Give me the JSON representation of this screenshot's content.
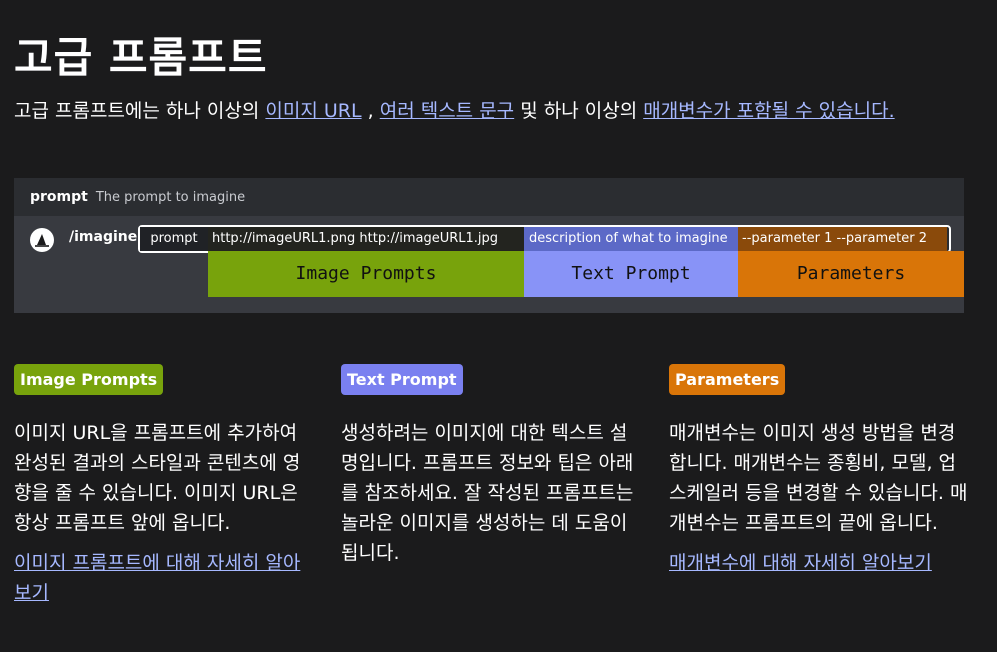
{
  "page": {
    "title": "고급 프롬프트",
    "intro_text1": "고급 프롬프트에는 하나 이상의 ",
    "intro_link1": "이미지 URL",
    "intro_text2": " , ",
    "intro_link2": "여러 텍스트 문구",
    "intro_text3": " 및 하나 이상의 ",
    "intro_link3": "매개변수가 포함될 수 있습니다."
  },
  "diagram": {
    "prompt_label": "prompt",
    "prompt_desc": "The prompt to imagine",
    "command": "/imagine",
    "seg_prompt": "prompt",
    "seg_images": "http://imageURL1.png   http://imageURL1.jpg",
    "seg_text": "description of what to imagine",
    "seg_params": "--parameter 1   --parameter 2",
    "band_images": "Image Prompts",
    "band_text": "Text Prompt",
    "band_params": "Parameters",
    "colors": {
      "image": "#78a30c",
      "text": "#8893f7",
      "params": "#d97508"
    }
  },
  "columns": [
    {
      "badge": "Image Prompts",
      "text": "이미지 URL을 프롬프트에 추가하여 완성된 결과의 스타일과 콘텐츠에 영향을 줄 수 있습니다. 이미지 URL은 항상 프롬프트 앞에 옵니다.",
      "link": "이미지 프롬프트에 대해 자세히 알아보기"
    },
    {
      "badge": "Text Prompt",
      "text": "생성하려는 이미지에 대한 텍스트 설명입니다. 프롬프트 정보와 팁은 아래를 참조하세요. 잘 작성된 프롬프트는 놀라운 이미지를 생성하는 데 도움이 됩니다."
    },
    {
      "badge": "Parameters",
      "text": "매개변수는 이미지 생성 방법을 변경합니다. 매개변수는 종횡비, 모델, 업스케일러 등을 변경할 수 있습니다. 매개변수는 프롬프트의 끝에 옵니다.",
      "link": "매개변수에 대해 자세히 알아보기"
    }
  ]
}
